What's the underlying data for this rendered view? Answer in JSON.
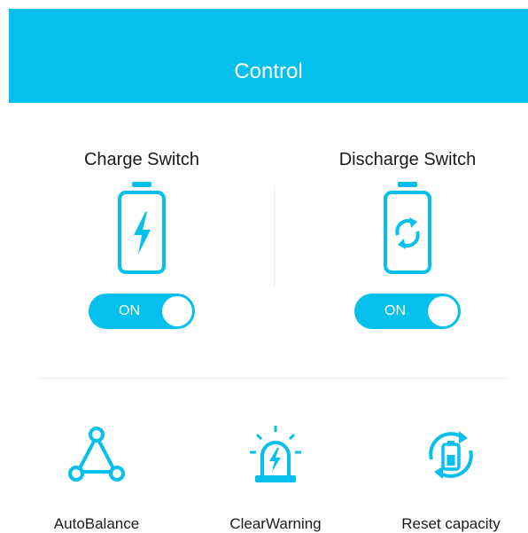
{
  "header": {
    "title": "Control"
  },
  "switches": {
    "charge": {
      "label": "Charge Switch",
      "state": "ON",
      "icon": "battery-charging-icon"
    },
    "discharge": {
      "label": "Discharge Switch",
      "state": "ON",
      "icon": "battery-cycle-icon"
    }
  },
  "actions": [
    {
      "label": "AutoBalance",
      "icon": "triangle-nodes-icon"
    },
    {
      "label": "ClearWarning",
      "icon": "alarm-light-icon"
    },
    {
      "label": "Reset capacity",
      "icon": "battery-reset-icon"
    }
  ],
  "colors": {
    "accent": "#05c0ec",
    "text": "#1a1a1a"
  }
}
